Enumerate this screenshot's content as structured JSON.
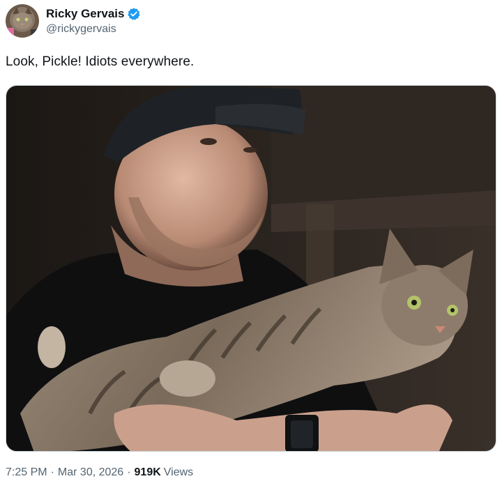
{
  "author": {
    "display_name": "Ricky Gervais",
    "handle": "@rickygervais",
    "verified_icon": "verified-badge-icon",
    "verified_color": "#1d9bf0"
  },
  "tweet": {
    "text": "Look, Pickle! Idiots everywhere."
  },
  "meta": {
    "time": "7:25 PM",
    "separator": "·",
    "date": "Mar 30, 2026",
    "views_count": "919K",
    "views_label": "Views"
  },
  "colors": {
    "text_primary": "#0f1419",
    "text_secondary": "#536471",
    "border": "#cfd9de"
  }
}
